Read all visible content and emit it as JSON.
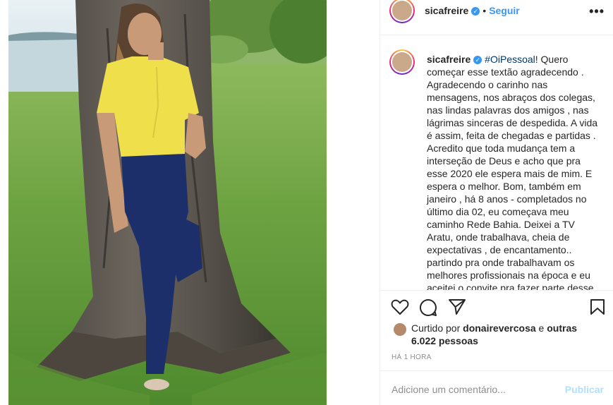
{
  "post": {
    "username": "sicafreire",
    "dot": "•",
    "follow_label": "Seguir",
    "more_label": "•••"
  },
  "caption": {
    "username": "sicafreire",
    "hashtag": "#OiPessoal",
    "text": "! Quero começar esse textão agradecendo . Agradecendo o carinho nas mensagens, nos abraços dos colegas, nas lindas palavras dos amigos , nas lágrimas sinceras de despedida. A vida é assim, feita de chegadas e partidas . Acredito que toda mudança tem a interseção de Deus e acho que pra esse 2020 ele espera mais de mim. E espera o melhor. Bom, também em janeiro , há 8 anos - completados no último dia 02, eu começava meu caminho Rede Bahia. Deixei a TV Aratu, onde trabalhava, cheia de expectativas , de encantamento.. partindo pra onde trabalhavam os melhores profissionais na época e eu aceitei o convite pra fazer parte desse"
  },
  "likes": {
    "prefix": "Curtido por ",
    "user": "donairevercosa",
    "middle": " e ",
    "others": "outras 6.022 pessoas"
  },
  "timestamp": "HÁ 1 HORA",
  "comment": {
    "placeholder": "Adicione um comentário...",
    "publish_label": "Publicar"
  },
  "colors": {
    "accent": "#3897f0",
    "hashtag": "#00376b",
    "publish_disabled": "#b2dffc"
  },
  "icons": [
    "verified-icon",
    "more-icon",
    "heart-icon",
    "comment-icon",
    "share-icon",
    "bookmark-icon"
  ]
}
